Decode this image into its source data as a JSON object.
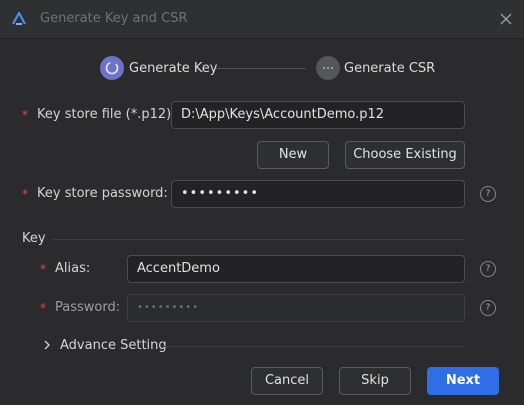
{
  "window": {
    "title": "Generate Key and CSR"
  },
  "steps": [
    {
      "label": "Generate Key",
      "state": "active"
    },
    {
      "label": "Generate CSR",
      "state": "pending"
    }
  ],
  "form": {
    "required_mark": "*",
    "keystore_file": {
      "label": "Key store file (*.p12):",
      "value": "D:\\App\\Keys\\AccountDemo.p12"
    },
    "new_button": "New",
    "choose_existing_button": "Choose Existing",
    "keystore_password": {
      "label": "Key store password:",
      "value": "•••••••••"
    },
    "key_section_label": "Key",
    "alias": {
      "label": "Alias:",
      "value": "AccentDemo"
    },
    "password": {
      "label": "Password:",
      "value": "•••••••••"
    },
    "advance_setting_label": "Advance Setting",
    "help_glyph": "?"
  },
  "footer": {
    "cancel": "Cancel",
    "skip": "Skip",
    "next": "Next"
  },
  "colors": {
    "background": "#2b2b2d",
    "accent": "#2f6ee6",
    "step_active": "#6b74c8",
    "required": "#e5484d"
  }
}
